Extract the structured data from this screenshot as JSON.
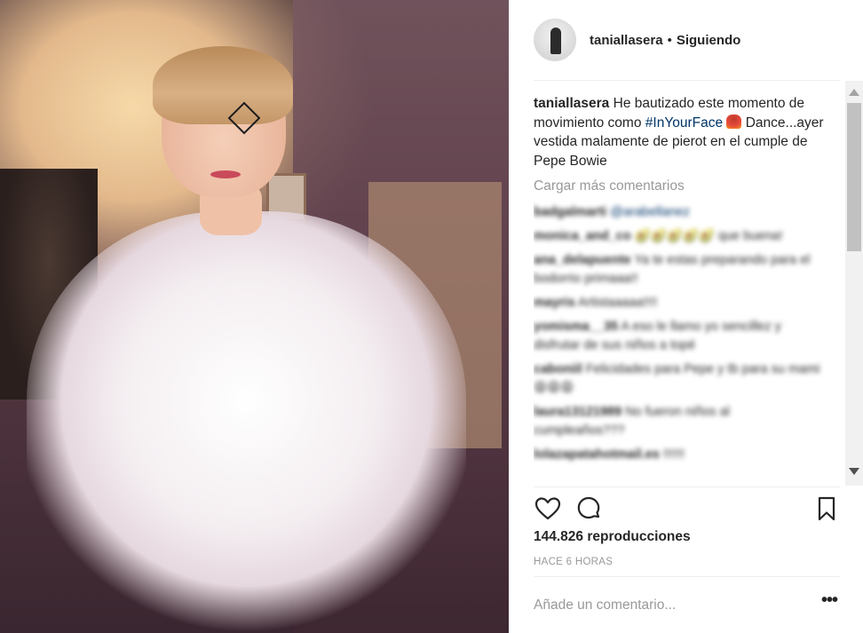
{
  "post": {
    "username": "taniallasera",
    "separator": "•",
    "follow_status": "Siguiendo",
    "caption_user": "taniallasera",
    "caption_before": "He bautizado este momento de movimiento como ",
    "caption_tag": "#InYourFace",
    "caption_after": " Dance...ayer vestida malamente de pierot en el cumple de Pepe Bowie",
    "load_more": "Cargar más comentarios",
    "comments": [
      {
        "user": "badgalmarti",
        "text": "",
        "mention": "@arabellanez"
      },
      {
        "user": "monica_and_co",
        "text": "🥑🥑🥑🥑🥑 que buena!",
        "mention": ""
      },
      {
        "user": "ana_delapuente",
        "text": "Ya te estas preparando para el bodorrio primaaa!!",
        "mention": ""
      },
      {
        "user": "mayris",
        "text": "Artistaaaaa!!!!",
        "mention": ""
      },
      {
        "user": "yomisma__35",
        "text": "A eso le llamo yo sencillez y disfrutar de sus niños a topé",
        "mention": ""
      },
      {
        "user": "caboniil",
        "text": "Felicidades para Pepe y tb para su mami😩😩😩",
        "mention": ""
      },
      {
        "user": "laura13121989",
        "text": "No fueron niños al cumpleaños???",
        "mention": ""
      },
      {
        "user": "lolazapatahotmail.es",
        "text": "!!!!!!",
        "mention": ""
      }
    ],
    "views": "144.826 reproducciones",
    "time_ago": "HACE 6 HORAS",
    "comment_placeholder": "Añade un comentario...",
    "more_label": "•••"
  },
  "icons": {
    "like": "heart-icon",
    "comment": "comment-icon",
    "save": "bookmark-icon",
    "more": "more-options-icon"
  }
}
